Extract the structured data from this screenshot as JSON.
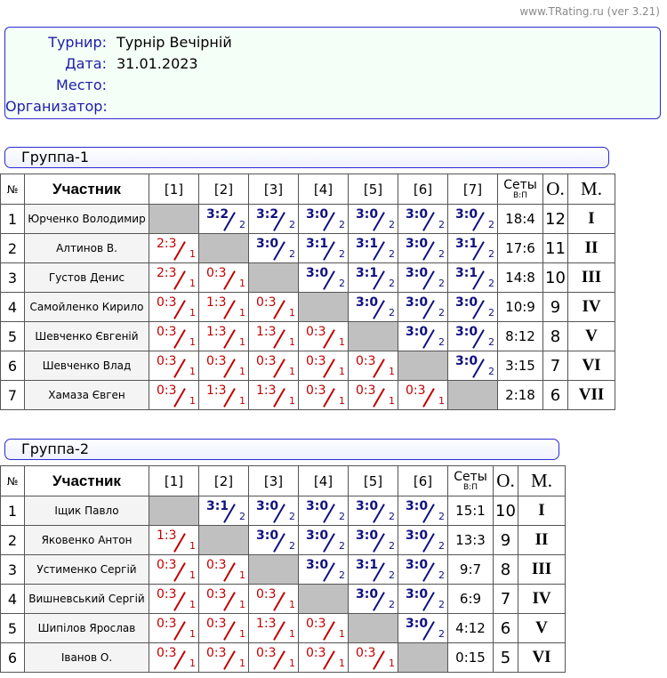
{
  "version": "www.TRating.ru (ver 3.21)",
  "tournament": {
    "rows": [
      {
        "label": "Турнир:",
        "value": "Турнір Вечірній"
      },
      {
        "label": "Дата:",
        "value": "31.01.2023"
      },
      {
        "label": "Место:",
        "value": ""
      },
      {
        "label": "Организатор:",
        "value": ""
      }
    ]
  },
  "headers": {
    "num": "№",
    "name": "Участник",
    "sets": "Сеты",
    "sets_sub": "В:П",
    "points": "О.",
    "place": "М."
  },
  "groups": [
    {
      "title": "Группа-1",
      "columns": [
        "[1]",
        "[2]",
        "[3]",
        "[4]",
        "[5]",
        "[6]",
        "[7]"
      ],
      "players": [
        {
          "n": "1",
          "name": "Юрченко Володимир",
          "results": [
            null,
            [
              "3:2",
              "2"
            ],
            [
              "3:2",
              "2"
            ],
            [
              "3:0",
              "2"
            ],
            [
              "3:0",
              "2"
            ],
            [
              "3:0",
              "2"
            ],
            [
              "3:0",
              "2"
            ]
          ],
          "sets": "18:4",
          "points": "12",
          "place": "I"
        },
        {
          "n": "2",
          "name": "Алтинов В.",
          "results": [
            [
              "2:3",
              "1"
            ],
            null,
            [
              "3:0",
              "2"
            ],
            [
              "3:1",
              "2"
            ],
            [
              "3:1",
              "2"
            ],
            [
              "3:0",
              "2"
            ],
            [
              "3:1",
              "2"
            ]
          ],
          "sets": "17:6",
          "points": "11",
          "place": "II"
        },
        {
          "n": "3",
          "name": "Густов Денис",
          "results": [
            [
              "2:3",
              "1"
            ],
            [
              "0:3",
              "1"
            ],
            null,
            [
              "3:0",
              "2"
            ],
            [
              "3:1",
              "2"
            ],
            [
              "3:0",
              "2"
            ],
            [
              "3:1",
              "2"
            ]
          ],
          "sets": "14:8",
          "points": "10",
          "place": "III"
        },
        {
          "n": "4",
          "name": "Самойленко Кирило",
          "results": [
            [
              "0:3",
              "1"
            ],
            [
              "1:3",
              "1"
            ],
            [
              "0:3",
              "1"
            ],
            null,
            [
              "3:0",
              "2"
            ],
            [
              "3:0",
              "2"
            ],
            [
              "3:0",
              "2"
            ]
          ],
          "sets": "10:9",
          "points": "9",
          "place": "IV"
        },
        {
          "n": "5",
          "name": "Шевченко Євгеній",
          "results": [
            [
              "0:3",
              "1"
            ],
            [
              "1:3",
              "1"
            ],
            [
              "1:3",
              "1"
            ],
            [
              "0:3",
              "1"
            ],
            null,
            [
              "3:0",
              "2"
            ],
            [
              "3:0",
              "2"
            ]
          ],
          "sets": "8:12",
          "points": "8",
          "place": "V"
        },
        {
          "n": "6",
          "name": "Шевченко Влад",
          "results": [
            [
              "0:3",
              "1"
            ],
            [
              "0:3",
              "1"
            ],
            [
              "0:3",
              "1"
            ],
            [
              "0:3",
              "1"
            ],
            [
              "0:3",
              "1"
            ],
            null,
            [
              "3:0",
              "2"
            ]
          ],
          "sets": "3:15",
          "points": "7",
          "place": "VI"
        },
        {
          "n": "7",
          "name": "Хамаза Євген",
          "results": [
            [
              "0:3",
              "1"
            ],
            [
              "1:3",
              "1"
            ],
            [
              "1:3",
              "1"
            ],
            [
              "0:3",
              "1"
            ],
            [
              "0:3",
              "1"
            ],
            [
              "0:3",
              "1"
            ],
            null
          ],
          "sets": "2:18",
          "points": "6",
          "place": "VII"
        }
      ]
    },
    {
      "title": "Группа-2",
      "columns": [
        "[1]",
        "[2]",
        "[3]",
        "[4]",
        "[5]",
        "[6]"
      ],
      "players": [
        {
          "n": "1",
          "name": "Іщик Павло",
          "results": [
            null,
            [
              "3:1",
              "2"
            ],
            [
              "3:0",
              "2"
            ],
            [
              "3:0",
              "2"
            ],
            [
              "3:0",
              "2"
            ],
            [
              "3:0",
              "2"
            ]
          ],
          "sets": "15:1",
          "points": "10",
          "place": "I"
        },
        {
          "n": "2",
          "name": "Яковенко Антон",
          "results": [
            [
              "1:3",
              "1"
            ],
            null,
            [
              "3:0",
              "2"
            ],
            [
              "3:0",
              "2"
            ],
            [
              "3:0",
              "2"
            ],
            [
              "3:0",
              "2"
            ]
          ],
          "sets": "13:3",
          "points": "9",
          "place": "II"
        },
        {
          "n": "3",
          "name": "Устименко Сергій",
          "results": [
            [
              "0:3",
              "1"
            ],
            [
              "0:3",
              "1"
            ],
            null,
            [
              "3:0",
              "2"
            ],
            [
              "3:1",
              "2"
            ],
            [
              "3:0",
              "2"
            ]
          ],
          "sets": "9:7",
          "points": "8",
          "place": "III"
        },
        {
          "n": "4",
          "name": "Вишневський Сергій",
          "results": [
            [
              "0:3",
              "1"
            ],
            [
              "0:3",
              "1"
            ],
            [
              "0:3",
              "1"
            ],
            null,
            [
              "3:0",
              "2"
            ],
            [
              "3:0",
              "2"
            ]
          ],
          "sets": "6:9",
          "points": "7",
          "place": "IV"
        },
        {
          "n": "5",
          "name": "Шипілов Ярослав",
          "results": [
            [
              "0:3",
              "1"
            ],
            [
              "0:3",
              "1"
            ],
            [
              "1:3",
              "1"
            ],
            [
              "0:3",
              "1"
            ],
            null,
            [
              "3:0",
              "2"
            ]
          ],
          "sets": "4:12",
          "points": "6",
          "place": "V"
        },
        {
          "n": "6",
          "name": "Іванов О.",
          "results": [
            [
              "0:3",
              "1"
            ],
            [
              "0:3",
              "1"
            ],
            [
              "0:3",
              "1"
            ],
            [
              "0:3",
              "1"
            ],
            [
              "0:3",
              "1"
            ],
            null
          ],
          "sets": "0:15",
          "points": "5",
          "place": "VI"
        }
      ]
    }
  ]
}
